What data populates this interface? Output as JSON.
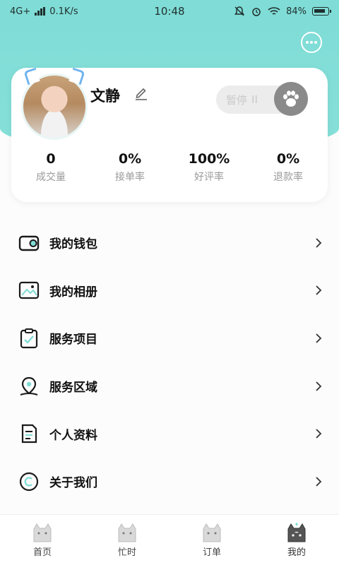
{
  "status_bar": {
    "network": "4G+",
    "speed": "0.1K/s",
    "time": "10:48",
    "battery": "84%"
  },
  "profile": {
    "name": "文静",
    "pause_label": "暂停",
    "stats": [
      {
        "value": "0",
        "label": "成交量"
      },
      {
        "value": "0%",
        "label": "接单率"
      },
      {
        "value": "100%",
        "label": "好评率"
      },
      {
        "value": "0%",
        "label": "退款率"
      }
    ]
  },
  "menu": {
    "items": [
      {
        "label": "我的钱包",
        "icon": "wallet-icon"
      },
      {
        "label": "我的相册",
        "icon": "album-icon"
      },
      {
        "label": "服务项目",
        "icon": "clipboard-icon"
      },
      {
        "label": "服务区域",
        "icon": "location-icon"
      },
      {
        "label": "个人资料",
        "icon": "document-icon"
      },
      {
        "label": "关于我们",
        "icon": "copyright-icon"
      }
    ]
  },
  "tabbar": {
    "tabs": [
      {
        "label": "首页",
        "icon": "cat-home-icon"
      },
      {
        "label": "忙时",
        "icon": "cat-busy-icon"
      },
      {
        "label": "订单",
        "icon": "cat-order-icon"
      },
      {
        "label": "我的",
        "icon": "cat-profile-icon"
      }
    ],
    "active_index": 3
  },
  "colors": {
    "accent": "#7fdcd6",
    "icon_dark": "#1a1a1a"
  }
}
